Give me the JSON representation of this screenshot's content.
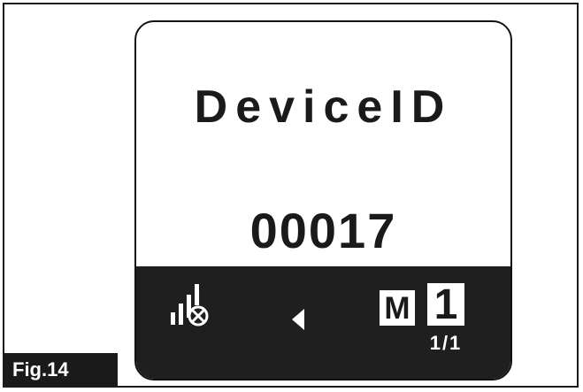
{
  "screen": {
    "title": "DeviceID",
    "value": "00017"
  },
  "statusbar": {
    "signal_icon": "signal-bars-disconnected-icon",
    "nav_icon": "left-arrow-icon",
    "mode_label": "M",
    "mode_number": "1",
    "page_indicator": "1/1"
  },
  "figure": {
    "label": "Fig.14"
  },
  "colors": {
    "background": "#ffffff",
    "dark": "#1f1f1f",
    "text": "#1a1a1a"
  }
}
